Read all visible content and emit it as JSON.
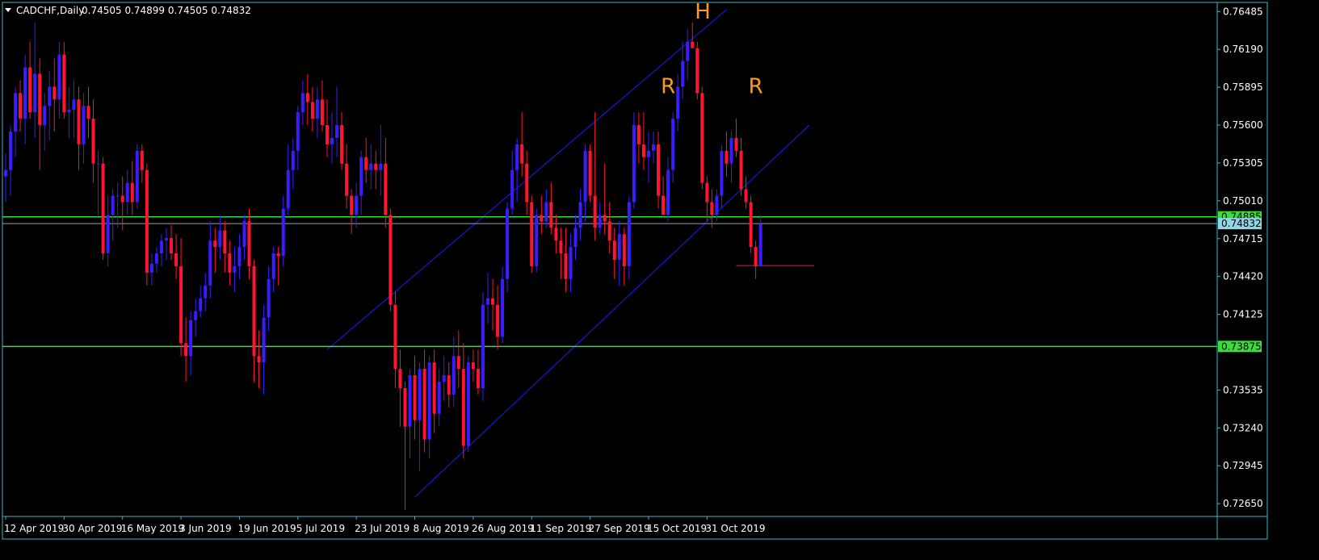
{
  "header": {
    "symbol": "CADCHF,Daily",
    "ohlc": "0.74505 0.74899 0.74505 0.74832"
  },
  "colors": {
    "background": "#000000",
    "bull": "#3a1cff",
    "bear": "#ff1530",
    "channel": "#1a1aff",
    "level": "#3ddc3d",
    "current_price": "#8fd6e8",
    "pattern_label": "#ff9a1a",
    "border": "#3fb6c5"
  },
  "chart_data": {
    "type": "candlestick",
    "title": "CADCHF,Daily",
    "ylim": [
      0.7255,
      0.7655
    ],
    "y_ticks": [
      "0.76485",
      "0.76190",
      "0.75895",
      "0.75600",
      "0.75305",
      "0.75010",
      "0.74715",
      "0.74420",
      "0.74125",
      "0.73535",
      "0.73240",
      "0.72945",
      "0.72650"
    ],
    "x_ticks": [
      {
        "label": "12 Apr 2019",
        "index": 0
      },
      {
        "label": "30 Apr 2019",
        "index": 12
      },
      {
        "label": "16 May 2019",
        "index": 24
      },
      {
        "label": "3 Jun 2019",
        "index": 36
      },
      {
        "label": "19 Jun 2019",
        "index": 48
      },
      {
        "label": "5 Jul 2019",
        "index": 60
      },
      {
        "label": "23 Jul 2019",
        "index": 72
      },
      {
        "label": "8 Aug 2019",
        "index": 84
      },
      {
        "label": "26 Aug 2019",
        "index": 96
      },
      {
        "label": "11 Sep 2019",
        "index": 108
      },
      {
        "label": "27 Sep 2019",
        "index": 120
      },
      {
        "label": "15 Oct 2019",
        "index": 132
      },
      {
        "label": "31 Oct 2019",
        "index": 144
      }
    ],
    "candles": [
      [
        0.752,
        0.7538,
        0.75,
        0.7525
      ],
      [
        0.7525,
        0.756,
        0.7505,
        0.7555
      ],
      [
        0.7555,
        0.759,
        0.7535,
        0.7585
      ],
      [
        0.7585,
        0.7595,
        0.7555,
        0.7565
      ],
      [
        0.7565,
        0.7615,
        0.7545,
        0.7605
      ],
      [
        0.7605,
        0.7625,
        0.7565,
        0.757
      ],
      [
        0.757,
        0.764,
        0.755,
        0.76
      ],
      [
        0.76,
        0.7612,
        0.7525,
        0.756
      ],
      [
        0.756,
        0.7585,
        0.754,
        0.7575
      ],
      [
        0.7575,
        0.7602,
        0.7548,
        0.759
      ],
      [
        0.759,
        0.7612,
        0.7555,
        0.758
      ],
      [
        0.758,
        0.7625,
        0.7565,
        0.7615
      ],
      [
        0.7615,
        0.7625,
        0.7565,
        0.757
      ],
      [
        0.757,
        0.759,
        0.755,
        0.7572
      ],
      [
        0.7572,
        0.7595,
        0.755,
        0.758
      ],
      [
        0.758,
        0.759,
        0.7525,
        0.7545
      ],
      [
        0.7545,
        0.7585,
        0.753,
        0.7575
      ],
      [
        0.7575,
        0.759,
        0.755,
        0.7565
      ],
      [
        0.7565,
        0.758,
        0.7515,
        0.753
      ],
      [
        0.753,
        0.754,
        0.749,
        0.753
      ],
      [
        0.753,
        0.7535,
        0.7455,
        0.746
      ],
      [
        0.746,
        0.7505,
        0.745,
        0.749
      ],
      [
        0.749,
        0.751,
        0.747,
        0.7505
      ],
      [
        0.7505,
        0.7515,
        0.748,
        0.7505
      ],
      [
        0.7505,
        0.752,
        0.7478,
        0.75
      ],
      [
        0.75,
        0.7525,
        0.749,
        0.7515
      ],
      [
        0.7515,
        0.7532,
        0.749,
        0.75
      ],
      [
        0.75,
        0.7545,
        0.7495,
        0.754
      ],
      [
        0.754,
        0.7545,
        0.7515,
        0.7525
      ],
      [
        0.7525,
        0.753,
        0.7435,
        0.7445
      ],
      [
        0.7445,
        0.746,
        0.7435,
        0.7452
      ],
      [
        0.7452,
        0.7465,
        0.7445,
        0.746
      ],
      [
        0.746,
        0.7475,
        0.745,
        0.747
      ],
      [
        0.747,
        0.748,
        0.7455,
        0.7472
      ],
      [
        0.7472,
        0.7482,
        0.7455,
        0.746
      ],
      [
        0.746,
        0.7475,
        0.744,
        0.745
      ],
      [
        0.745,
        0.7472,
        0.738,
        0.739
      ],
      [
        0.739,
        0.741,
        0.736,
        0.738
      ],
      [
        0.738,
        0.7415,
        0.7365,
        0.7408
      ],
      [
        0.7408,
        0.7425,
        0.7395,
        0.7415
      ],
      [
        0.7415,
        0.7435,
        0.741,
        0.7425
      ],
      [
        0.7425,
        0.7445,
        0.7415,
        0.7435
      ],
      [
        0.7435,
        0.7485,
        0.7425,
        0.747
      ],
      [
        0.747,
        0.748,
        0.7445,
        0.7465
      ],
      [
        0.7465,
        0.749,
        0.7455,
        0.7478
      ],
      [
        0.7478,
        0.7485,
        0.7445,
        0.746
      ],
      [
        0.746,
        0.747,
        0.7435,
        0.7445
      ],
      [
        0.7445,
        0.7465,
        0.743,
        0.745
      ],
      [
        0.745,
        0.7475,
        0.744,
        0.7465
      ],
      [
        0.7465,
        0.749,
        0.7455,
        0.7485
      ],
      [
        0.7485,
        0.7495,
        0.744,
        0.745
      ],
      [
        0.745,
        0.7455,
        0.736,
        0.738
      ],
      [
        0.738,
        0.74,
        0.7355,
        0.7375
      ],
      [
        0.7375,
        0.742,
        0.735,
        0.741
      ],
      [
        0.741,
        0.745,
        0.74,
        0.744
      ],
      [
        0.744,
        0.7465,
        0.743,
        0.746
      ],
      [
        0.746,
        0.7465,
        0.7435,
        0.7458
      ],
      [
        0.7458,
        0.7505,
        0.745,
        0.7495
      ],
      [
        0.7495,
        0.7545,
        0.749,
        0.7525
      ],
      [
        0.7525,
        0.755,
        0.751,
        0.754
      ],
      [
        0.754,
        0.7575,
        0.7525,
        0.757
      ],
      [
        0.757,
        0.7595,
        0.756,
        0.7585
      ],
      [
        0.7585,
        0.76,
        0.756,
        0.7578
      ],
      [
        0.7578,
        0.759,
        0.7555,
        0.7565
      ],
      [
        0.7565,
        0.759,
        0.755,
        0.758
      ],
      [
        0.758,
        0.7595,
        0.7555,
        0.756
      ],
      [
        0.756,
        0.758,
        0.7535,
        0.7545
      ],
      [
        0.7545,
        0.757,
        0.753,
        0.755
      ],
      [
        0.755,
        0.759,
        0.7535,
        0.756
      ],
      [
        0.756,
        0.757,
        0.7525,
        0.753
      ],
      [
        0.753,
        0.7545,
        0.7495,
        0.7505
      ],
      [
        0.7505,
        0.751,
        0.7475,
        0.749
      ],
      [
        0.749,
        0.7515,
        0.748,
        0.7505
      ],
      [
        0.7505,
        0.754,
        0.749,
        0.7535
      ],
      [
        0.7535,
        0.755,
        0.7515,
        0.7525
      ],
      [
        0.7525,
        0.7545,
        0.751,
        0.753
      ],
      [
        0.753,
        0.754,
        0.751,
        0.7525
      ],
      [
        0.7525,
        0.756,
        0.7505,
        0.753
      ],
      [
        0.753,
        0.755,
        0.748,
        0.749
      ],
      [
        0.749,
        0.7495,
        0.7415,
        0.742
      ],
      [
        0.742,
        0.743,
        0.7355,
        0.737
      ],
      [
        0.737,
        0.7385,
        0.7325,
        0.7355
      ],
      [
        0.7355,
        0.736,
        0.726,
        0.7325
      ],
      [
        0.7325,
        0.737,
        0.73,
        0.7365
      ],
      [
        0.7365,
        0.738,
        0.7315,
        0.733
      ],
      [
        0.733,
        0.7375,
        0.729,
        0.737
      ],
      [
        0.737,
        0.7385,
        0.7305,
        0.7315
      ],
      [
        0.7315,
        0.738,
        0.73,
        0.7375
      ],
      [
        0.7375,
        0.7385,
        0.732,
        0.7335
      ],
      [
        0.7335,
        0.737,
        0.7325,
        0.736
      ],
      [
        0.736,
        0.738,
        0.7345,
        0.7365
      ],
      [
        0.7365,
        0.7375,
        0.734,
        0.735
      ],
      [
        0.735,
        0.7395,
        0.734,
        0.738
      ],
      [
        0.738,
        0.74,
        0.7355,
        0.737
      ],
      [
        0.737,
        0.739,
        0.73,
        0.731
      ],
      [
        0.731,
        0.738,
        0.7305,
        0.7375
      ],
      [
        0.7375,
        0.7385,
        0.736,
        0.737
      ],
      [
        0.737,
        0.7385,
        0.735,
        0.7355
      ],
      [
        0.7355,
        0.743,
        0.7345,
        0.742
      ],
      [
        0.742,
        0.7445,
        0.7405,
        0.7425
      ],
      [
        0.7425,
        0.744,
        0.74,
        0.742
      ],
      [
        0.742,
        0.7435,
        0.7385,
        0.7395
      ],
      [
        0.7395,
        0.745,
        0.739,
        0.744
      ],
      [
        0.744,
        0.75,
        0.743,
        0.7495
      ],
      [
        0.7495,
        0.754,
        0.749,
        0.7525
      ],
      [
        0.7525,
        0.755,
        0.75,
        0.7545
      ],
      [
        0.7545,
        0.757,
        0.752,
        0.753
      ],
      [
        0.753,
        0.754,
        0.749,
        0.75
      ],
      [
        0.75,
        0.7505,
        0.7445,
        0.745
      ],
      [
        0.745,
        0.7495,
        0.7445,
        0.749
      ],
      [
        0.749,
        0.7505,
        0.7475,
        0.7485
      ],
      [
        0.7485,
        0.751,
        0.748,
        0.75
      ],
      [
        0.75,
        0.7515,
        0.7475,
        0.748
      ],
      [
        0.748,
        0.749,
        0.746,
        0.747
      ],
      [
        0.747,
        0.748,
        0.744,
        0.746
      ],
      [
        0.746,
        0.748,
        0.743,
        0.744
      ],
      [
        0.744,
        0.7475,
        0.743,
        0.7465
      ],
      [
        0.7465,
        0.749,
        0.7455,
        0.748
      ],
      [
        0.748,
        0.751,
        0.747,
        0.75
      ],
      [
        0.75,
        0.7545,
        0.7485,
        0.754
      ],
      [
        0.754,
        0.7545,
        0.75,
        0.7505
      ],
      [
        0.7505,
        0.757,
        0.747,
        0.748
      ],
      [
        0.748,
        0.75,
        0.7475,
        0.749
      ],
      [
        0.749,
        0.753,
        0.7475,
        0.7485
      ],
      [
        0.7485,
        0.75,
        0.746,
        0.747
      ],
      [
        0.747,
        0.748,
        0.744,
        0.7455
      ],
      [
        0.7455,
        0.7485,
        0.7435,
        0.7475
      ],
      [
        0.7475,
        0.748,
        0.7435,
        0.745
      ],
      [
        0.745,
        0.7505,
        0.744,
        0.75
      ],
      [
        0.75,
        0.757,
        0.7495,
        0.756
      ],
      [
        0.756,
        0.757,
        0.753,
        0.7545
      ],
      [
        0.7545,
        0.757,
        0.7525,
        0.7535
      ],
      [
        0.7535,
        0.7555,
        0.7515,
        0.754
      ],
      [
        0.754,
        0.7555,
        0.753,
        0.7545
      ],
      [
        0.7545,
        0.7555,
        0.7495,
        0.7505
      ],
      [
        0.7505,
        0.752,
        0.749,
        0.749
      ],
      [
        0.749,
        0.7535,
        0.7485,
        0.7525
      ],
      [
        0.7525,
        0.757,
        0.7515,
        0.7565
      ],
      [
        0.7565,
        0.76,
        0.7555,
        0.759
      ],
      [
        0.759,
        0.7625,
        0.758,
        0.761
      ],
      [
        0.761,
        0.7635,
        0.7595,
        0.7625
      ],
      [
        0.7625,
        0.764,
        0.762,
        0.762
      ],
      [
        0.762,
        0.7625,
        0.758,
        0.7585
      ],
      [
        0.7585,
        0.759,
        0.751,
        0.7515
      ],
      [
        0.7515,
        0.752,
        0.7485,
        0.75
      ],
      [
        0.75,
        0.751,
        0.748,
        0.749
      ],
      [
        0.749,
        0.751,
        0.7485,
        0.7505
      ],
      [
        0.7505,
        0.7545,
        0.7495,
        0.754
      ],
      [
        0.754,
        0.7555,
        0.752,
        0.753
      ],
      [
        0.753,
        0.7555,
        0.7515,
        0.755
      ],
      [
        0.755,
        0.7565,
        0.7535,
        0.754
      ],
      [
        0.754,
        0.755,
        0.7505,
        0.751
      ],
      [
        0.751,
        0.752,
        0.7495,
        0.75
      ],
      [
        0.75,
        0.7505,
        0.746,
        0.7465
      ],
      [
        0.7465,
        0.747,
        0.744,
        0.745
      ],
      [
        0.745,
        0.749,
        0.745,
        0.7483
      ]
    ],
    "annotations": [
      {
        "text": "R",
        "x_index": 136,
        "y": 0.7585
      },
      {
        "text": "H",
        "x_index": 143,
        "y": 0.7643
      },
      {
        "text": "R",
        "x_index": 154,
        "y": 0.7585
      }
    ],
    "lines": {
      "channel_upper": {
        "from": [
          66,
          0.7385
        ],
        "to": [
          148,
          0.765
        ]
      },
      "channel_lower": {
        "from": [
          84,
          0.727
        ],
        "to": [
          165,
          0.756
        ]
      },
      "support_short": {
        "from": [
          150,
          0.74505
        ],
        "to": [
          166,
          0.74505
        ]
      }
    },
    "horizontal_levels": [
      {
        "value": "0.74885",
        "style": "green"
      },
      {
        "value": "0.74832",
        "style": "current"
      },
      {
        "value": "0.73875",
        "style": "green"
      }
    ]
  }
}
